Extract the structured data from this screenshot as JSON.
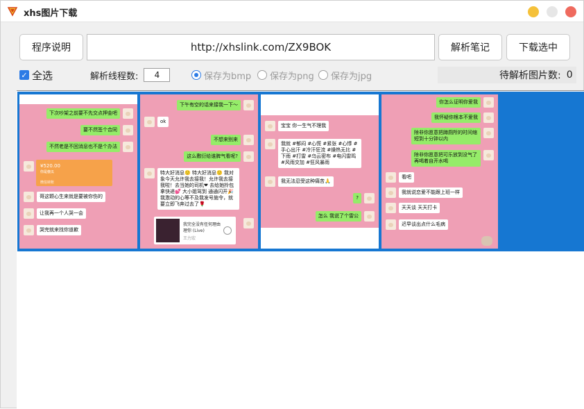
{
  "window": {
    "title": "xhs图片下载"
  },
  "toolbar": {
    "help_label": "程序说明",
    "url_value": "http://xhslink.com/ZX9BOK",
    "parse_label": "解析笔记",
    "download_label": "下载选中"
  },
  "options": {
    "select_all_label": "全选",
    "select_all_checked": true,
    "threads_label": "解析线程数:",
    "threads_value": "4",
    "save_bmp_label": "保存为bmp",
    "save_png_label": "保存为png",
    "save_jpg_label": "保存为jpg",
    "selected_format": "bmp",
    "pending_label": "待解析图片数:",
    "pending_count": "0"
  },
  "colors": {
    "selection": "#1677d2",
    "chat_bg": "#ef9fb5",
    "bubble_green": "#95ec69",
    "transfer_orange": "#f6a24a"
  },
  "thumbnails": [
    {
      "messages": [
        "下次吵架之前要不先交点押金吧",
        "要不然签个合同",
        "不然老是不回消息也不是个办法",
        "哥这颗心生来就是要被你伤的",
        "让我再一个人哭一会",
        "哭完就来找你道歉"
      ],
      "transfer": {
        "amount": "¥520.00",
        "status": "你是傻瓜",
        "source": "微信转账"
      }
    },
    {
      "messages": [
        "下午有空的话来接我一下～",
        "ok",
        "不想来别来",
        "这么敷衍给谁脾气看呢?",
        "特大好消息🙂 特大好消息🙂 我对象今天允许我去接我！允许我去接我啦！去当她的司机❤ 去给她拎包拿快递💕 大小姐驾到 通通闪开🎉 我激动的心等不及我发号施令，就要立即飞奔过去了🌹"
      ],
      "music": {
        "title": "我完全没有任何理由理你 (Live)",
        "artist": "王力宏"
      }
    },
    {
      "messages": [
        "宝宝 你一生气不理我",
        "我就 #郁闷 #心慌 #紧张 #心悸 #手心出汗 #冷汗狂流 #燥热无比 #下雨 #打雷 #乌云密布 #电闪雷鸣 #风雨交加 #狂风暴雨",
        "我无法忍受这种痛苦🙏",
        "?",
        "怎么 我说了个雷公"
      ]
    },
    {
      "messages": [
        "你怎么证明你爱我",
        "我怀疑你根本不爱我",
        "除非你愿意把蹲厕所的时间缩短到十分钟以内",
        "除非你愿意把可乐放到没气了再喝着自开水喝",
        "看吧",
        "我就说恋爱不能跟上班一样",
        "天天谈 天天打卡",
        "迟早谈出点什么毛病"
      ]
    }
  ]
}
